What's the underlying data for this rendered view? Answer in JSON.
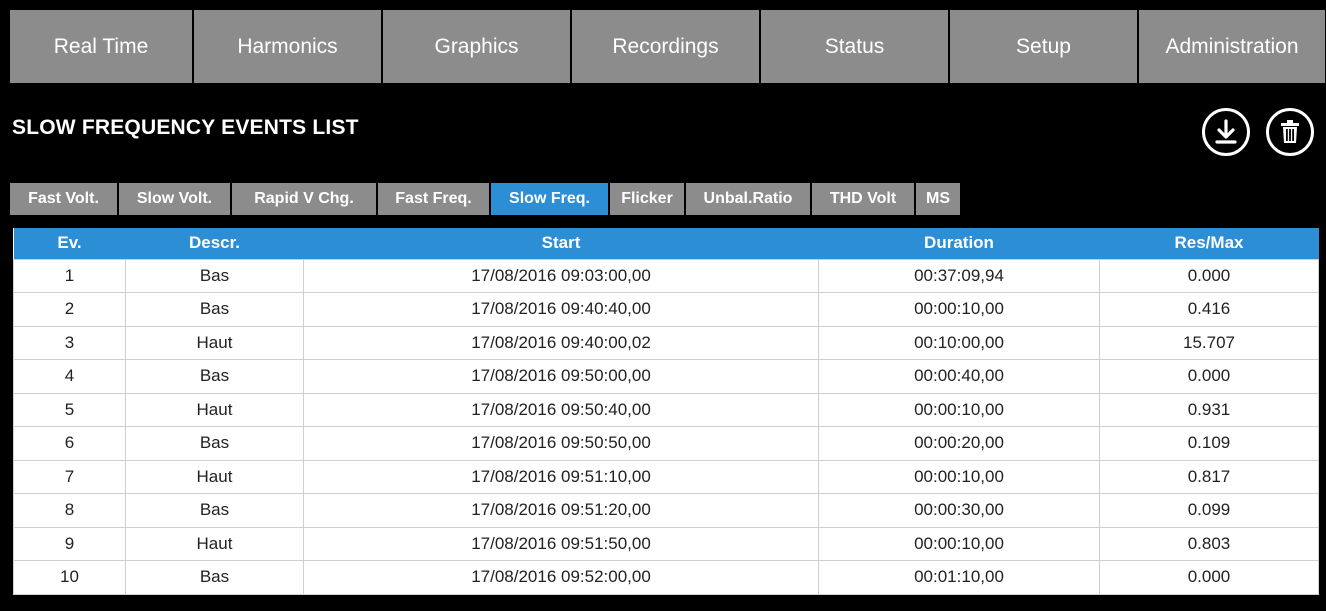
{
  "menu": {
    "items": [
      {
        "label": "Real Time"
      },
      {
        "label": "Harmonics"
      },
      {
        "label": "Graphics"
      },
      {
        "label": "Recordings"
      },
      {
        "label": "Status"
      },
      {
        "label": "Setup"
      },
      {
        "label": "Administration"
      }
    ]
  },
  "page": {
    "title": "SLOW FREQUENCY EVENTS LIST",
    "download_icon": "download-icon",
    "delete_icon": "trash-icon"
  },
  "tabs": {
    "active": "Slow Freq.",
    "items": [
      {
        "label": "Fast Volt."
      },
      {
        "label": "Slow Volt."
      },
      {
        "label": "Rapid V Chg."
      },
      {
        "label": "Fast Freq."
      },
      {
        "label": "Slow Freq."
      },
      {
        "label": "Flicker"
      },
      {
        "label": "Unbal.Ratio"
      },
      {
        "label": "THD Volt"
      },
      {
        "label": "MS"
      }
    ]
  },
  "colors": {
    "accent": "#2c8fd6",
    "menu_bg": "#8c8c8c",
    "background": "#000000"
  },
  "table": {
    "headers": [
      "Ev.",
      "Descr.",
      "Start",
      "Duration",
      "Res/Max"
    ],
    "rows": [
      [
        "1",
        "Bas",
        "17/08/2016 09:03:00,00",
        "00:37:09,94",
        "0.000"
      ],
      [
        "2",
        "Bas",
        "17/08/2016 09:40:40,00",
        "00:00:10,00",
        "0.416"
      ],
      [
        "3",
        "Haut",
        "17/08/2016 09:40:00,02",
        "00:10:00,00",
        "15.707"
      ],
      [
        "4",
        "Bas",
        "17/08/2016 09:50:00,00",
        "00:00:40,00",
        "0.000"
      ],
      [
        "5",
        "Haut",
        "17/08/2016 09:50:40,00",
        "00:00:10,00",
        "0.931"
      ],
      [
        "6",
        "Bas",
        "17/08/2016 09:50:50,00",
        "00:00:20,00",
        "0.109"
      ],
      [
        "7",
        "Haut",
        "17/08/2016 09:51:10,00",
        "00:00:10,00",
        "0.817"
      ],
      [
        "8",
        "Bas",
        "17/08/2016 09:51:20,00",
        "00:00:30,00",
        "0.099"
      ],
      [
        "9",
        "Haut",
        "17/08/2016 09:51:50,00",
        "00:00:10,00",
        "0.803"
      ],
      [
        "10",
        "Bas",
        "17/08/2016 09:52:00,00",
        "00:01:10,00",
        "0.000"
      ]
    ]
  }
}
